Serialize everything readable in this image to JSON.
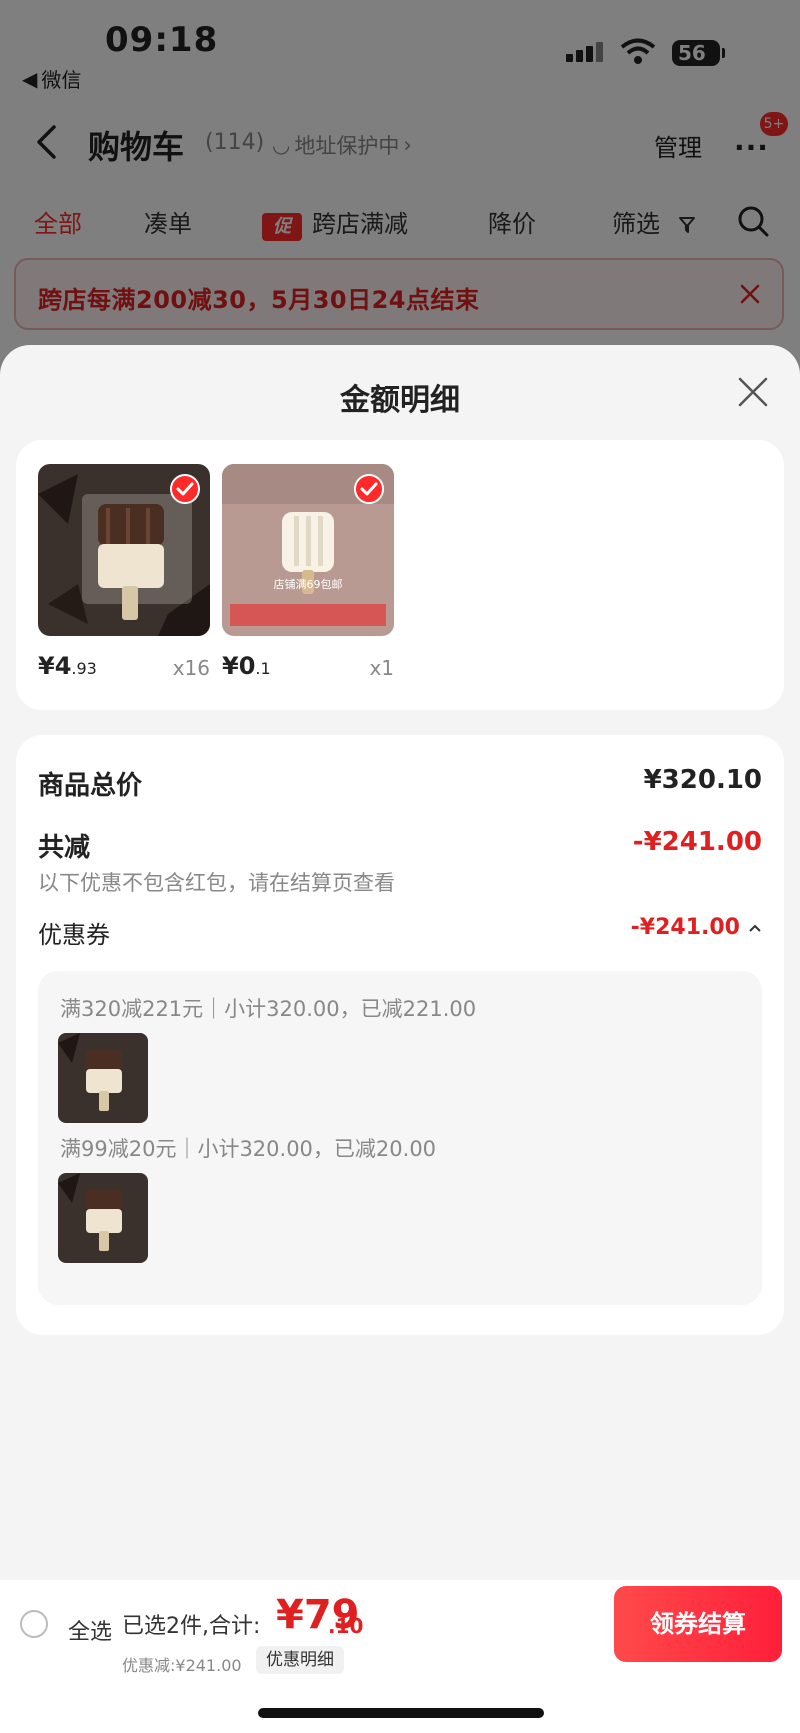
{
  "status": {
    "time": "09:18",
    "back_app": "微信",
    "battery": "56"
  },
  "navbar": {
    "title": "购物车",
    "count": "(114)",
    "protect": "地址保护中",
    "manage": "管理",
    "more": "...",
    "badge": "5+"
  },
  "tabs": {
    "all": "全部",
    "bundle": "凑单",
    "promo_badge": "促",
    "cross_store": "跨店满减",
    "price_drop": "降价",
    "filter": "筛选"
  },
  "banner": {
    "text": "跨店每满200减30，5月30日24点结束"
  },
  "sheet": {
    "title": "金额明细",
    "products": [
      {
        "price_main": "¥4",
        "price_decimal": ".93",
        "qty": "x16"
      },
      {
        "price_main": "¥0",
        "price_decimal": ".1",
        "qty": "x1"
      }
    ],
    "product2_caption": "店铺满69包邮",
    "summary": {
      "total_label": "商品总价",
      "total_value": "¥320.10",
      "reduce_label": "共减",
      "reduce_value": "-¥241.00",
      "note": "以下优惠不包含红包，请在结算页查看",
      "coupon_label": "优惠券",
      "coupon_value": "-¥241.00",
      "coupon_lines": [
        "满320减221元｜小计320.00，已减221.00",
        "满99减20元｜小计320.00，已减20.00"
      ]
    }
  },
  "bottom": {
    "select_all": "全选",
    "selected": "已选2件,合计:",
    "total_big": "¥79",
    "total_small": ".10",
    "discount": "优惠减:¥241.00",
    "detail": "优惠明细",
    "checkout": "领券结算"
  },
  "colors": {
    "accent": "#e02020",
    "checkout": "#ff2a3a",
    "overlay": "rgba(0,0,0,0.5)"
  }
}
